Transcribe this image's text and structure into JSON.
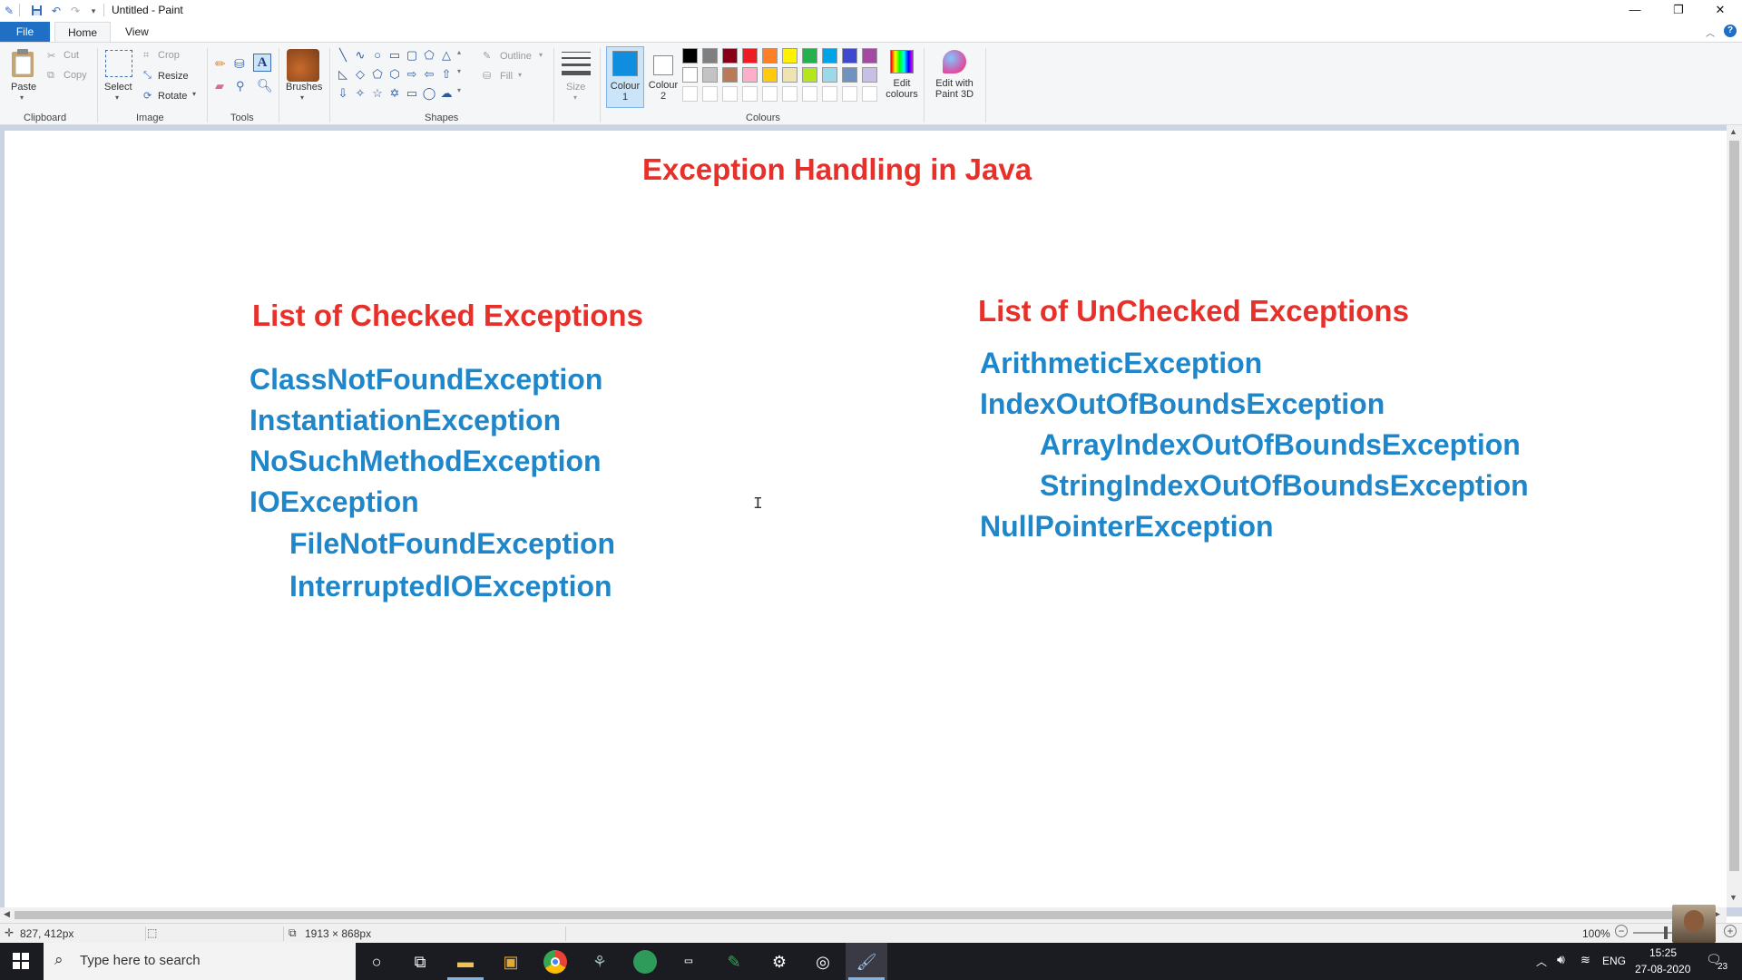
{
  "window": {
    "title": "Untitled - Paint",
    "controls": {
      "minimize": "—",
      "restore": "❐",
      "close": "✕"
    }
  },
  "menu_tabs": {
    "file": "File",
    "home": "Home",
    "view": "View"
  },
  "ribbon": {
    "clipboard": {
      "paste": "Paste",
      "cut": "Cut",
      "copy": "Copy",
      "group": "Clipboard"
    },
    "image": {
      "select": "Select",
      "crop": "Crop",
      "resize": "Resize",
      "rotate": "Rotate",
      "group": "Image"
    },
    "tools": {
      "group": "Tools"
    },
    "brushes": {
      "label": "Brushes"
    },
    "shapes": {
      "outline": "Outline",
      "fill": "Fill",
      "group": "Shapes"
    },
    "size": {
      "label": "Size"
    },
    "colours": {
      "colour1": "Colour\n1",
      "colour1_line1": "Colour",
      "colour1_line2": "1",
      "colour2_line1": "Colour",
      "colour2_line2": "2",
      "edit_line1": "Edit",
      "edit_line2": "colours",
      "group": "Colours",
      "active_colour": "#0f8ee0",
      "palette_row1": [
        "#000000",
        "#7f7f7f",
        "#880015",
        "#ed1c24",
        "#ff7f27",
        "#fff200",
        "#22b14c",
        "#00a2e8",
        "#3f48cc",
        "#a349a4"
      ],
      "palette_row2": [
        "#ffffff",
        "#c3c3c3",
        "#b97a57",
        "#ffaec9",
        "#ffc90e",
        "#efe4b0",
        "#b5e61d",
        "#99d9ea",
        "#7092be",
        "#c8bfe7"
      ]
    },
    "paint3d": {
      "line1": "Edit with",
      "line2": "Paint 3D"
    }
  },
  "canvas": {
    "title": "Exception Handling in Java",
    "checked_heading": "List of Checked Exceptions",
    "checked": [
      "ClassNotFoundException",
      "InstantiationException",
      "NoSuchMethodException",
      "IOException",
      "FileNotFoundException",
      "InterruptedIOException"
    ],
    "unchecked_heading": "List of UnChecked Exceptions",
    "unchecked": [
      "ArithmeticException",
      "IndexOutOfBoundsException",
      "ArrayIndexOutOfBoundsException",
      "StringIndexOutOfBoundsException",
      "NullPointerException"
    ],
    "heading_color": "#e8302a",
    "item_color": "#1f86c9"
  },
  "statusbar": {
    "cursor_pos": "827, 412px",
    "canvas_size": "1913 × 868px",
    "zoom": "100%"
  },
  "taskbar": {
    "search_placeholder": "Type here to search",
    "lang": "ENG",
    "time": "15:25",
    "date": "27-08-2020",
    "notifications": "23"
  }
}
